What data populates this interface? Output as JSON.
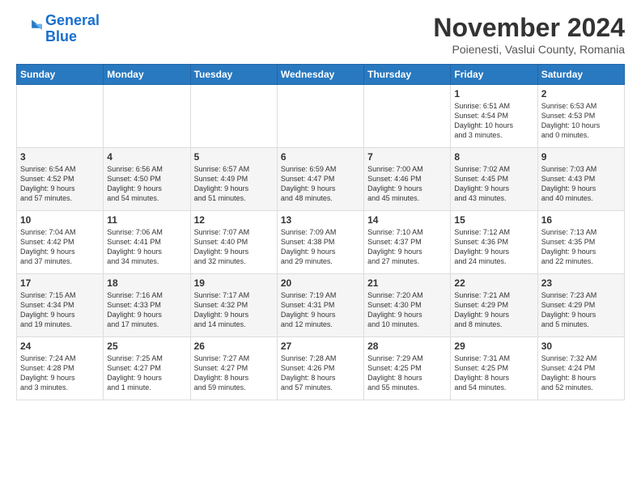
{
  "logo": {
    "line1": "General",
    "line2": "Blue"
  },
  "header": {
    "title": "November 2024",
    "location": "Poienesti, Vaslui County, Romania"
  },
  "days_of_week": [
    "Sunday",
    "Monday",
    "Tuesday",
    "Wednesday",
    "Thursday",
    "Friday",
    "Saturday"
  ],
  "weeks": [
    [
      {
        "day": "",
        "info": ""
      },
      {
        "day": "",
        "info": ""
      },
      {
        "day": "",
        "info": ""
      },
      {
        "day": "",
        "info": ""
      },
      {
        "day": "",
        "info": ""
      },
      {
        "day": "1",
        "info": "Sunrise: 6:51 AM\nSunset: 4:54 PM\nDaylight: 10 hours\nand 3 minutes."
      },
      {
        "day": "2",
        "info": "Sunrise: 6:53 AM\nSunset: 4:53 PM\nDaylight: 10 hours\nand 0 minutes."
      }
    ],
    [
      {
        "day": "3",
        "info": "Sunrise: 6:54 AM\nSunset: 4:52 PM\nDaylight: 9 hours\nand 57 minutes."
      },
      {
        "day": "4",
        "info": "Sunrise: 6:56 AM\nSunset: 4:50 PM\nDaylight: 9 hours\nand 54 minutes."
      },
      {
        "day": "5",
        "info": "Sunrise: 6:57 AM\nSunset: 4:49 PM\nDaylight: 9 hours\nand 51 minutes."
      },
      {
        "day": "6",
        "info": "Sunrise: 6:59 AM\nSunset: 4:47 PM\nDaylight: 9 hours\nand 48 minutes."
      },
      {
        "day": "7",
        "info": "Sunrise: 7:00 AM\nSunset: 4:46 PM\nDaylight: 9 hours\nand 45 minutes."
      },
      {
        "day": "8",
        "info": "Sunrise: 7:02 AM\nSunset: 4:45 PM\nDaylight: 9 hours\nand 43 minutes."
      },
      {
        "day": "9",
        "info": "Sunrise: 7:03 AM\nSunset: 4:43 PM\nDaylight: 9 hours\nand 40 minutes."
      }
    ],
    [
      {
        "day": "10",
        "info": "Sunrise: 7:04 AM\nSunset: 4:42 PM\nDaylight: 9 hours\nand 37 minutes."
      },
      {
        "day": "11",
        "info": "Sunrise: 7:06 AM\nSunset: 4:41 PM\nDaylight: 9 hours\nand 34 minutes."
      },
      {
        "day": "12",
        "info": "Sunrise: 7:07 AM\nSunset: 4:40 PM\nDaylight: 9 hours\nand 32 minutes."
      },
      {
        "day": "13",
        "info": "Sunrise: 7:09 AM\nSunset: 4:38 PM\nDaylight: 9 hours\nand 29 minutes."
      },
      {
        "day": "14",
        "info": "Sunrise: 7:10 AM\nSunset: 4:37 PM\nDaylight: 9 hours\nand 27 minutes."
      },
      {
        "day": "15",
        "info": "Sunrise: 7:12 AM\nSunset: 4:36 PM\nDaylight: 9 hours\nand 24 minutes."
      },
      {
        "day": "16",
        "info": "Sunrise: 7:13 AM\nSunset: 4:35 PM\nDaylight: 9 hours\nand 22 minutes."
      }
    ],
    [
      {
        "day": "17",
        "info": "Sunrise: 7:15 AM\nSunset: 4:34 PM\nDaylight: 9 hours\nand 19 minutes."
      },
      {
        "day": "18",
        "info": "Sunrise: 7:16 AM\nSunset: 4:33 PM\nDaylight: 9 hours\nand 17 minutes."
      },
      {
        "day": "19",
        "info": "Sunrise: 7:17 AM\nSunset: 4:32 PM\nDaylight: 9 hours\nand 14 minutes."
      },
      {
        "day": "20",
        "info": "Sunrise: 7:19 AM\nSunset: 4:31 PM\nDaylight: 9 hours\nand 12 minutes."
      },
      {
        "day": "21",
        "info": "Sunrise: 7:20 AM\nSunset: 4:30 PM\nDaylight: 9 hours\nand 10 minutes."
      },
      {
        "day": "22",
        "info": "Sunrise: 7:21 AM\nSunset: 4:29 PM\nDaylight: 9 hours\nand 8 minutes."
      },
      {
        "day": "23",
        "info": "Sunrise: 7:23 AM\nSunset: 4:29 PM\nDaylight: 9 hours\nand 5 minutes."
      }
    ],
    [
      {
        "day": "24",
        "info": "Sunrise: 7:24 AM\nSunset: 4:28 PM\nDaylight: 9 hours\nand 3 minutes."
      },
      {
        "day": "25",
        "info": "Sunrise: 7:25 AM\nSunset: 4:27 PM\nDaylight: 9 hours\nand 1 minute."
      },
      {
        "day": "26",
        "info": "Sunrise: 7:27 AM\nSunset: 4:27 PM\nDaylight: 8 hours\nand 59 minutes."
      },
      {
        "day": "27",
        "info": "Sunrise: 7:28 AM\nSunset: 4:26 PM\nDaylight: 8 hours\nand 57 minutes."
      },
      {
        "day": "28",
        "info": "Sunrise: 7:29 AM\nSunset: 4:25 PM\nDaylight: 8 hours\nand 55 minutes."
      },
      {
        "day": "29",
        "info": "Sunrise: 7:31 AM\nSunset: 4:25 PM\nDaylight: 8 hours\nand 54 minutes."
      },
      {
        "day": "30",
        "info": "Sunrise: 7:32 AM\nSunset: 4:24 PM\nDaylight: 8 hours\nand 52 minutes."
      }
    ]
  ]
}
